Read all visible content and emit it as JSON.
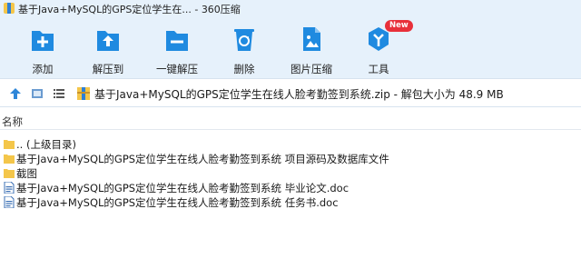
{
  "window": {
    "title": "基于Java+MySQL的GPS定位学生在...  - 360压缩"
  },
  "toolbar": {
    "items": [
      {
        "label": "添加",
        "icon": "add-icon"
      },
      {
        "label": "解压到",
        "icon": "extract-to-icon"
      },
      {
        "label": "一键解压",
        "icon": "one-click-extract-icon"
      },
      {
        "label": "删除",
        "icon": "recycle-bin-icon"
      },
      {
        "label": "图片压缩",
        "icon": "image-compress-icon"
      },
      {
        "label": "工具",
        "icon": "tools-icon",
        "badge": "New"
      }
    ]
  },
  "pathbar": {
    "path": "基于Java+MySQL的GPS定位学生在线人脸考勤签到系统.zip - 解包大小为 48.9 MB"
  },
  "list": {
    "column_name": "名称",
    "files": [
      {
        "name": ".. (上级目录)",
        "type": "folder"
      },
      {
        "name": "基于Java+MySQL的GPS定位学生在线人脸考勤签到系统 项目源码及数据库文件",
        "type": "folder"
      },
      {
        "name": "截图",
        "type": "folder"
      },
      {
        "name": "基于Java+MySQL的GPS定位学生在线人脸考勤签到系统 毕业论文.doc",
        "type": "doc"
      },
      {
        "name": "基于Java+MySQL的GPS定位学生在线人脸考勤签到系统 任务书.doc",
        "type": "doc"
      }
    ]
  },
  "colors": {
    "toolbar_bg": "#e6f1fb",
    "icon_blue": "#1f8ae0",
    "folder_yellow": "#f4c64a",
    "badge_red": "#e8303a"
  }
}
